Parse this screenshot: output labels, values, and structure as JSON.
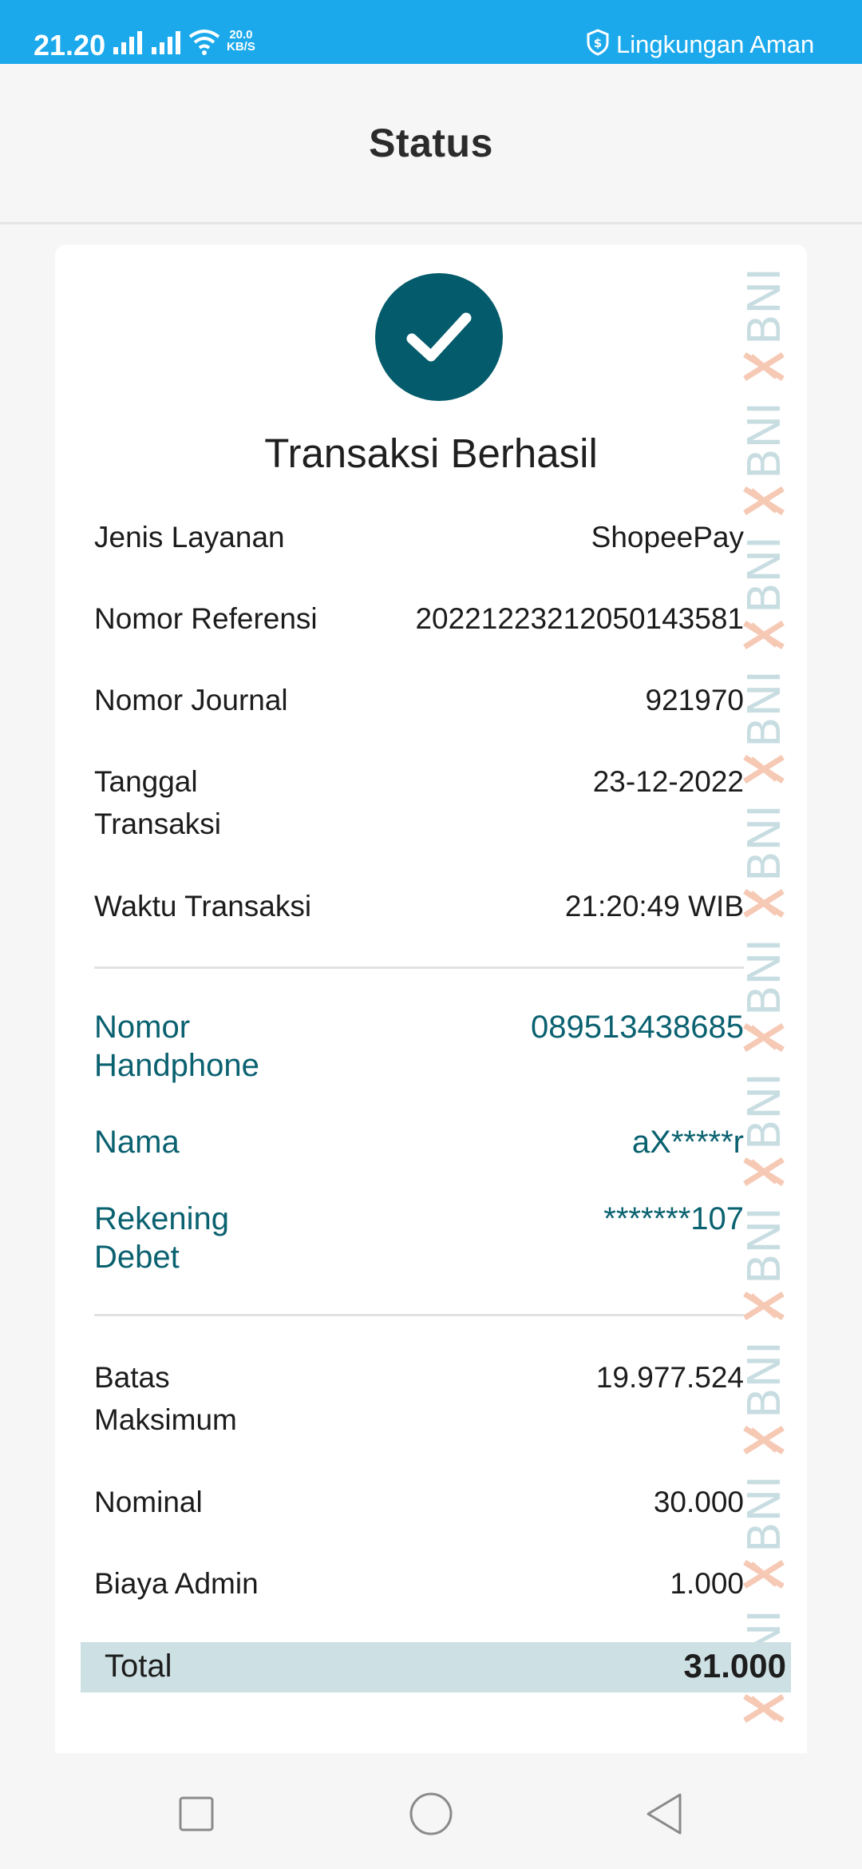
{
  "status_bar": {
    "time": "21.20",
    "speed_value": "20.0",
    "speed_unit": "KB/S",
    "safe_label": "Lingkungan Aman",
    "icons": [
      "signal-icon",
      "signal-icon",
      "wifi-icon",
      "shield-dollar-icon"
    ],
    "background": "#1ba9ec"
  },
  "header": {
    "title": "Status"
  },
  "result": {
    "icon": "check-icon",
    "title": "Transaksi Berhasil",
    "accent_color": "#035b6b"
  },
  "transaction_details": [
    {
      "label": "Jenis Layanan",
      "value": "ShopeePay"
    },
    {
      "label": "Nomor Referensi",
      "value": "20221223212050143581"
    },
    {
      "label": "Nomor Journal",
      "value": "921970"
    },
    {
      "label": "Tanggal\nTransaksi",
      "value": "23-12-2022"
    },
    {
      "label": "Waktu Transaksi",
      "value": "21:20:49 WIB"
    }
  ],
  "account_details": [
    {
      "label": "Nomor\nHandphone",
      "value": "089513438685"
    },
    {
      "label": "Nama",
      "value": "aX*****r"
    },
    {
      "label": "Rekening\nDebet",
      "value": "*******107"
    }
  ],
  "amount_details": [
    {
      "label": "Batas\nMaksimum",
      "value": "19.977.524"
    },
    {
      "label": "Nominal",
      "value": "30.000"
    },
    {
      "label": "Biaya Admin",
      "value": "1.000"
    }
  ],
  "total": {
    "label": "Total",
    "value": "31.000"
  },
  "watermark": {
    "text": "BNI"
  },
  "nav_bar": {
    "icons": [
      "recent-apps-icon",
      "home-icon",
      "back-icon"
    ]
  }
}
